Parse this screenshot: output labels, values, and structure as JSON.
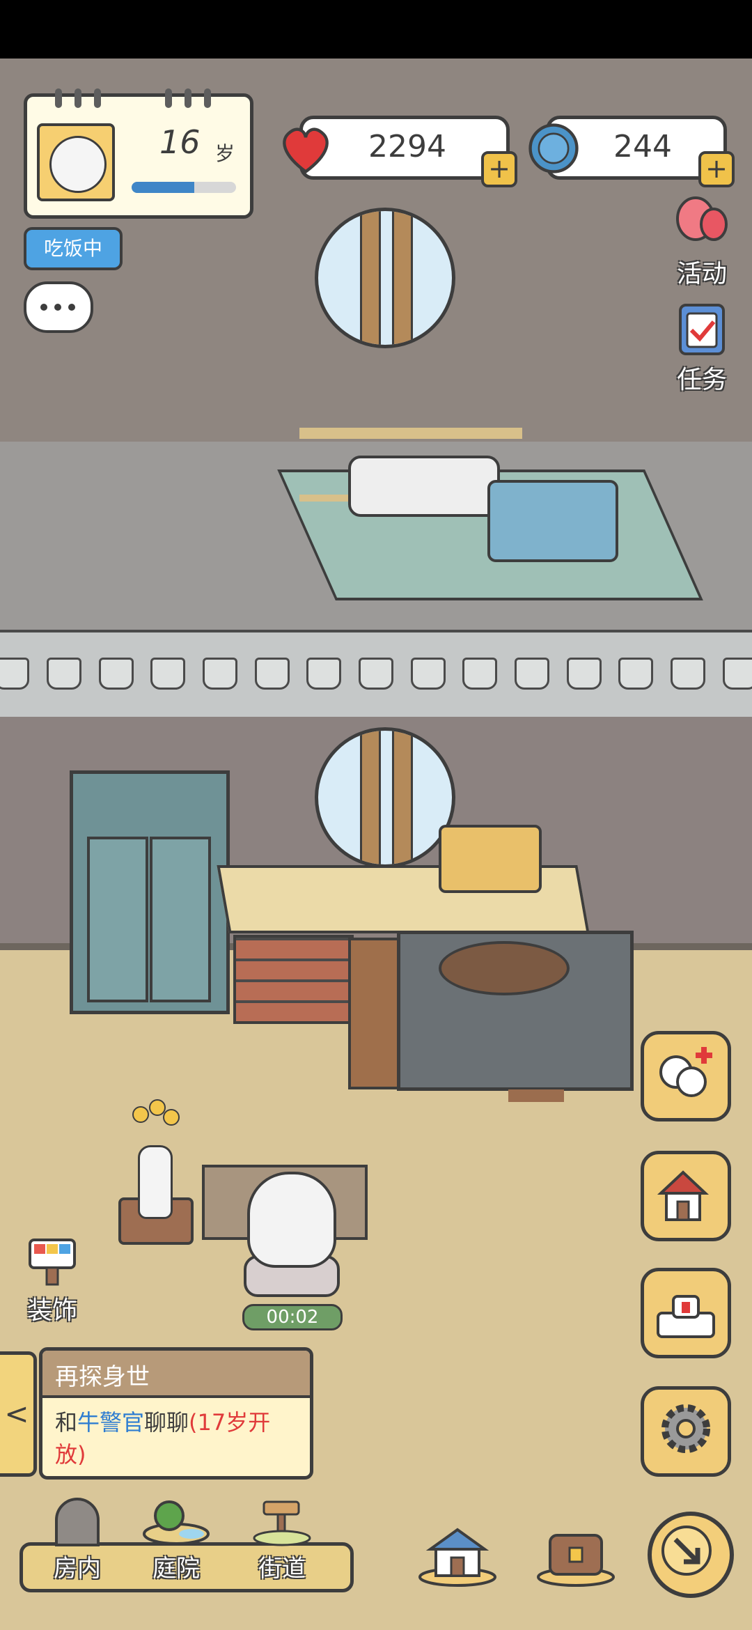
{
  "profile": {
    "age_value": "16",
    "age_unit": "岁",
    "growth_progress": 0.6
  },
  "status": {
    "activity_label": "吃饭中"
  },
  "resources": {
    "hearts": {
      "value": "2294",
      "plus": "+"
    },
    "bottlecaps": {
      "value": "244",
      "plus": "+"
    }
  },
  "side_menu": {
    "activity_label": "活动",
    "tasks_label": "任务"
  },
  "timer": {
    "value": "00:02"
  },
  "decorate": {
    "label": "装饰"
  },
  "quest": {
    "title": "再探身世",
    "body_prefix": "和",
    "highlight_name": "牛警官",
    "body_middle": "聊聊",
    "unlock_note": "(17岁开放)",
    "collapse_arrow": "<"
  },
  "nav": {
    "room_label": "房内",
    "yard_label": "庭院",
    "street_label": "街道"
  },
  "icons": {
    "heart": "heart-icon",
    "bottlecap": "bottlecap-icon",
    "balloon": "balloon-icon",
    "task": "clipboard-icon",
    "chat": "chat-bubble-icon",
    "add_panda": "add-panda-icon",
    "house": "house-icon",
    "podium": "podium-icon",
    "gear": "gear-icon",
    "home": "home-icon",
    "chest": "treasure-chest-icon",
    "compass": "compass-arrow-icon"
  },
  "colors": {
    "accent_blue": "#4EA3E3",
    "heart_red": "#E03A3A",
    "cap_blue": "#4B93C8",
    "plus_yellow": "#F0C24A",
    "quest_highlight": "#2E7DD1",
    "quest_unlock": "#E03A3A"
  }
}
